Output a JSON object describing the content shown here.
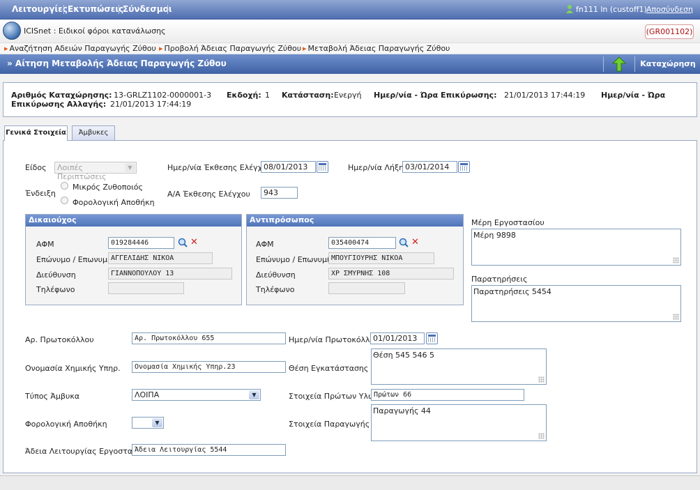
{
  "menu": {
    "items": [
      "Λειτουργίες",
      "Εκτυπώσεις",
      "Σύνδεσμοι"
    ],
    "user": "fn111 ln (custoff1)",
    "logout": "Αποσύνδεση"
  },
  "app": {
    "title": "ICISnet : Ειδικοί φόροι κατανάλωσης",
    "badge": "(GR001102)"
  },
  "breadcrumbs": [
    "Αναζήτηση Αδειών Παραγωγής Ζύθου",
    "Προβολή Άδειας Παραγωγής Ζύθου",
    "Μεταβολή Άδειας Παραγωγής Ζύθου"
  ],
  "page": {
    "title": "» Αίτηση Μεταβολής Άδειας Παραγωγής Ζύθου",
    "save": "Καταχώρηση"
  },
  "info": {
    "reg_label": "Αριθμός Καταχώρησης:",
    "reg_value": "13-GRLZ1102-0000001-3",
    "version_label": "Εκδοχή:",
    "version_value": "1",
    "status_label": "Κατάσταση:",
    "status_value": "Ενεργή",
    "confirm_label": "Ημερ/νία - Ώρα Επικύρωσης:",
    "confirm_value": "21/01/2013 17:44:19",
    "change_label_1": "Ημερ/νία - Ώρα",
    "change_label_2": "Επικύρωσης Αλλαγής:",
    "change_value": "21/01/2013 17:44:19"
  },
  "tabs": [
    "Γενικά Στοιχεία",
    "Άμβυκες"
  ],
  "form": {
    "type_label": "Είδος",
    "type_value": "Λοιπές Περιπτώσεις",
    "indication_label": "Ένδειξη",
    "radio1": "Μικρός Ζυθοποιός",
    "radio2": "Φορολογική Αποθήκη",
    "inspection_date_label": "Ημερ/νία Έκθεσης Ελέγχου",
    "inspection_date": "08/01/2013",
    "expiry_label": "Ημερ/νία Λήξης",
    "expiry_date": "03/01/2014",
    "report_no_label": "Α/Α Έκθεσης Ελέγχου",
    "report_no": "943",
    "beneficiary": {
      "title": "Δικαιούχος",
      "afm_label": "ΑΦΜ",
      "afm": "019284446",
      "name_label": "Επώνυμο / Επωνυμία",
      "name": "ΑΓΓΕΛΙΔΗΣ ΝΙΚΟΑ",
      "addr_label": "Διεύθυνση",
      "addr": "ΓΙΑΝΝΟΠΟΥΛΟΥ 13",
      "phone_label": "Τηλέφωνο",
      "phone": ""
    },
    "representative": {
      "title": "Αντιπρόσωπος",
      "afm_label": "ΑΦΜ",
      "afm": "035400474",
      "name_label": "Επώνυμο / Επωνυμία",
      "name": "ΜΠΟΥΓΙΟΥΡΗΣ ΝΙΚΟΑ",
      "addr_label": "Διεύθυνση",
      "addr": "ΧΡ ΣΜΥΡΝΗΣ 108",
      "phone_label": "Τηλέφωνο",
      "phone": ""
    },
    "parts_label": "Μέρη Εργοστασίου",
    "parts": "Μέρη 9898",
    "remarks_label": "Παρατηρήσεις",
    "remarks": "Παρατηρήσεις 5454",
    "protocol_no_label": "Αρ. Πρωτοκόλλου",
    "protocol_no": "Αρ. Πρωτοκόλλου 655",
    "protocol_date_label": "Ημερ/νία Πρωτοκόλλου",
    "protocol_date": "01/01/2013",
    "chem_label": "Ονομασία Χημικής Υπηρ.",
    "chem": "Ονομασία Χημικής Υπηρ.23",
    "location_label": "Θέση Εγκατάστασης",
    "location": "Θέση 545 546 5",
    "still_type_label": "Τύπος Άμβυκα",
    "still_type": "ΛΟΙΠΑ",
    "raw_label": "Στοιχεία Πρώτων Υλών",
    "raw": "Πρώτων 66",
    "warehouse_label": "Φορολογική Αποθήκη",
    "warehouse": "",
    "production_label": "Στοιχεία Παραγωγής",
    "production": "Παραγωγής 44",
    "license_label": "Άδεια Λειτουργίας Εργοστασίου",
    "license": "Άδεια Λειτουργίας 5544"
  }
}
